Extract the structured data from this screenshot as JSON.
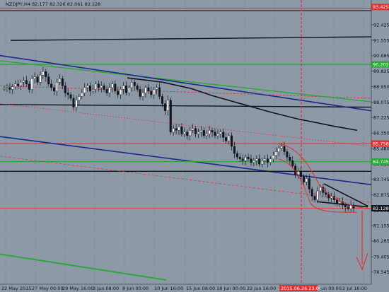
{
  "title": "NZDJPY,H4  82.177 82.326 82.061 82.128",
  "chart_data": {
    "type": "candlestick",
    "symbol": "NZDJPY",
    "timeframe": "H4",
    "ohlc_header": {
      "open": 82.177,
      "high": 82.326,
      "low": 82.061,
      "close": 82.128
    },
    "y_ticks": [
      "93.425",
      "92.425",
      "91.555",
      "90.685",
      "89.825",
      "88.950",
      "88.075",
      "87.225",
      "86.350",
      "85.480",
      "84.610",
      "83.745",
      "82.875",
      "82.005",
      "81.155",
      "80.285",
      "79.405",
      "78.545"
    ],
    "x_ticks": [
      "22 May 2015",
      "27 May 00:00",
      "29 May 16:00",
      "3 Jun 08:00",
      "8 Jun 00:00",
      "10 Jun 16:00",
      "15 Jun 08:00",
      "18 Jun 00:00",
      "22 Jun 16:00",
      "2015.06.26 23:00",
      "Jun 00:00",
      "2 Jul 16:00"
    ],
    "ylim": [
      78.1,
      93.5
    ],
    "price_tags": [
      {
        "value": 93.425,
        "label": "93.425",
        "color": "#e03030"
      },
      {
        "value": 90.202,
        "label": "90.202",
        "color": "#2aa838"
      },
      {
        "value": 85.758,
        "label": "85.758",
        "color": "#e03030"
      },
      {
        "value": 84.745,
        "label": "84.745",
        "color": "#2aa838"
      },
      {
        "value": 82.128,
        "label": "82.128",
        "color": "#10151c"
      }
    ],
    "current_time_label": "2015.06.26 23:00",
    "series": [
      {
        "name": "NZDJPY H4",
        "close": [
          88.85,
          88.9,
          88.8,
          88.95,
          89.1,
          89.0,
          89.2,
          89.3,
          89.1,
          88.8,
          89.4,
          89.5,
          89.2,
          89.6,
          89.8,
          89.5,
          89.1,
          88.9,
          88.7,
          89.2,
          89.4,
          89.0,
          88.6,
          88.5,
          88.3,
          87.8,
          88.2,
          88.4,
          88.6,
          88.9,
          89.0,
          88.7,
          88.8,
          89.1,
          88.9,
          89.0,
          88.8,
          88.6,
          88.9,
          89.1,
          88.7,
          88.5,
          88.8,
          89.0,
          88.6,
          88.9,
          89.2,
          89.0,
          88.8,
          88.4,
          88.6,
          88.9,
          88.7,
          88.5,
          88.8,
          88.9,
          88.4,
          88.0,
          87.6,
          88.2,
          86.4,
          86.6,
          86.5,
          86.7,
          86.3,
          86.4,
          86.2,
          86.5,
          86.6,
          86.3,
          86.4,
          86.5,
          86.2,
          86.3,
          86.5,
          86.4,
          86.2,
          86.3,
          86.4,
          86.1,
          85.9,
          86.2,
          85.6,
          85.2,
          85.0,
          84.9,
          84.8,
          85.0,
          84.9,
          84.7,
          84.8,
          84.9,
          84.6,
          84.8,
          84.9,
          84.7,
          84.9,
          85.1,
          85.3,
          85.5,
          85.6,
          85.3,
          85.0,
          84.8,
          84.5,
          84.0,
          84.2,
          83.9,
          83.6,
          83.8,
          83.2,
          82.8,
          82.6,
          83.1,
          83.3,
          83.0,
          82.9,
          82.7,
          82.8,
          82.6,
          82.4,
          82.5,
          82.3,
          82.2,
          82.1,
          82.3,
          82.13
        ]
      }
    ]
  },
  "icons": {
    "arrow": "red-down-arrow"
  }
}
